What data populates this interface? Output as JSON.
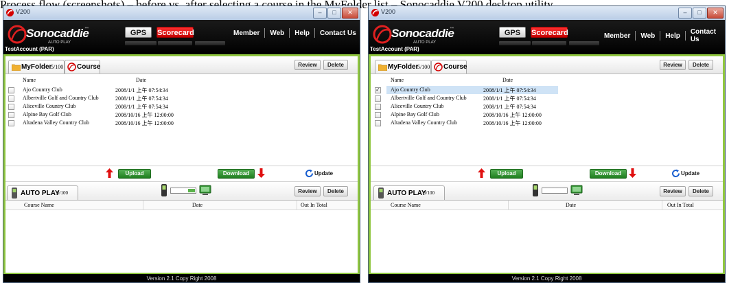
{
  "caption": "Process flow (screenshots) – before vs. after selecting a course in the MyFolder list – Sonocaddie V200 desktop utility.",
  "windows": [
    {
      "title": "V200",
      "window_buttons": [
        "–",
        "□",
        "✕"
      ],
      "logo": {
        "brand": "Sonocaddie",
        "tm": "™",
        "sub": "AUTO PLAY"
      },
      "nav_tabs": {
        "gps": "GPS",
        "scorecard": "Scorecard"
      },
      "top_nav": [
        "Member",
        "Web",
        "Help",
        "Contact Us"
      ],
      "account": "TestAccount (PAR)",
      "folder": {
        "tab_label": "MyFolder",
        "count": "5/100",
        "course_tab": "Course",
        "review": "Review",
        "delete": "Delete",
        "col_name": "Name",
        "col_date": "Date",
        "rows": [
          {
            "name": "Ajo Country Club",
            "date": "2008/1/1 上午 07:54:34",
            "checked": false
          },
          {
            "name": "Albertville Golf and Country Club",
            "date": "2008/1/1 上午 07:54:34",
            "checked": false
          },
          {
            "name": "Aliceville Country Club",
            "date": "2008/1/1 上午 07:54:34",
            "checked": false
          },
          {
            "name": "Alpine Bay Golf Club",
            "date": "2008/10/16 上午 12:00:00",
            "checked": false
          },
          {
            "name": "Altadena Valley Country Club",
            "date": "2008/10/16 上午 12:00:00",
            "checked": false
          }
        ]
      },
      "transfer": {
        "upload": "Upload",
        "download": "Download",
        "update": "Update"
      },
      "autoplay": {
        "tab_label": "AUTO PLAY",
        "count": "0/100",
        "review": "Review",
        "delete": "Delete",
        "col_course": "Course Name",
        "col_date": "Date",
        "col_out": "Out In Total"
      },
      "footer": "Version 2.1 Copy Right 2008"
    },
    {
      "title": "V200",
      "window_buttons": [
        "–",
        "□",
        "✕"
      ],
      "logo": {
        "brand": "Sonocaddie",
        "tm": "™",
        "sub": "AUTO PLAY"
      },
      "nav_tabs": {
        "gps": "GPS",
        "scorecard": "Scorecard"
      },
      "top_nav": [
        "Member",
        "Web",
        "Help",
        "Contact Us"
      ],
      "account": "TestAccount (PAR)",
      "folder": {
        "tab_label": "MyFolder",
        "count": "5/100",
        "course_tab": "Course",
        "review": "Review",
        "delete": "Delete",
        "col_name": "Name",
        "col_date": "Date",
        "rows": [
          {
            "name": "Ajo Country Club",
            "date": "2008/1/1 上午 07:54:34",
            "checked": true
          },
          {
            "name": "Albertville Golf and Country Club",
            "date": "2008/1/1 上午 07:54:34",
            "checked": false
          },
          {
            "name": "Aliceville Country Club",
            "date": "2008/1/1 上午 07:54:34",
            "checked": false
          },
          {
            "name": "Alpine Bay Golf Club",
            "date": "2008/10/16 上午 12:00:00",
            "checked": false
          },
          {
            "name": "Altadena Valley Country Club",
            "date": "2008/10/16 上午 12:00:00",
            "checked": false
          }
        ]
      },
      "transfer": {
        "upload": "Upload",
        "download": "Download",
        "update": "Update"
      },
      "autoplay": {
        "tab_label": "AUTO PLAY",
        "count": "0/100",
        "review": "Review",
        "delete": "Delete",
        "col_course": "Course Name",
        "col_date": "Date",
        "col_out": "Out In Total"
      },
      "footer": "Version 2.1 Copy Right 2008"
    }
  ],
  "colors": {
    "accent_green": "#8fc63f",
    "scorecard_red": "#d40000",
    "button_green": "#2e8b2e",
    "selection": "#cfe3f6"
  },
  "icons": {
    "app": "sonocaddie-icon",
    "folder": "folder-icon",
    "course": "golf-course-icon",
    "upload": "up-arrow-icon",
    "download": "down-arrow-icon",
    "update": "refresh-icon",
    "device": "gps-device-icon",
    "sync": "sync-progress-icon",
    "pc": "computer-icon",
    "autoplay": "device-icon"
  }
}
